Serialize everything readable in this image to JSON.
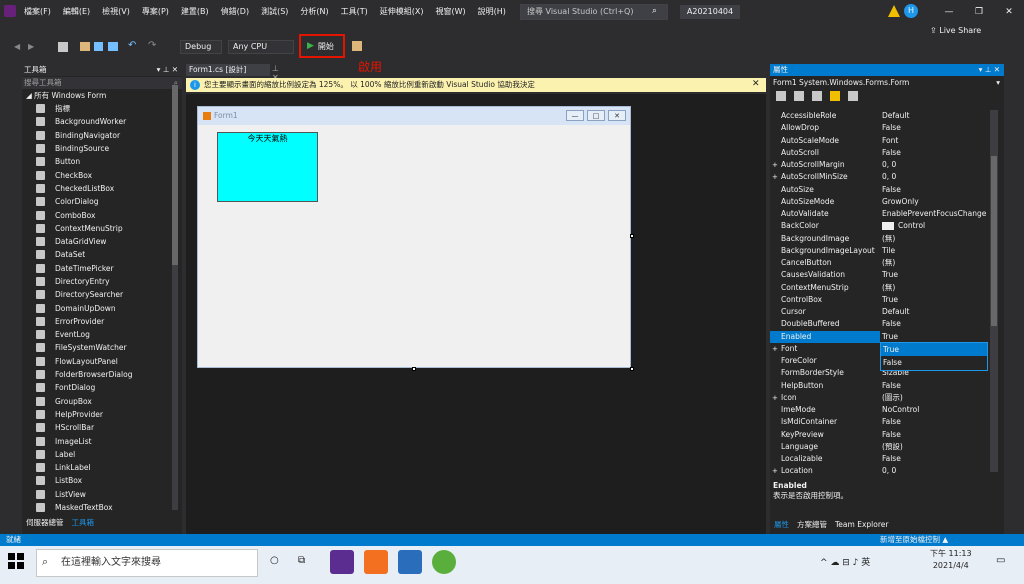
{
  "menubar": [
    "檔案(F)",
    "編輯(E)",
    "檢視(V)",
    "專案(P)",
    "建置(B)",
    "偵錯(D)",
    "測試(S)",
    "分析(N)",
    "工具(T)",
    "延伸模組(X)",
    "視窗(W)",
    "說明(H)"
  ],
  "search": {
    "placeholder": "搜尋 Visual Studio (Ctrl+Q)"
  },
  "solution_name": "A20210404",
  "live_share": "Live Share",
  "toolbar": {
    "config": "Debug",
    "platform": "Any CPU",
    "start": "開始",
    "start_annotation": "啟用"
  },
  "toolbox": {
    "title": "工具箱",
    "search": "搜尋工具箱",
    "group": "所有 Windows Form",
    "items": [
      "指標",
      "BackgroundWorker",
      "BindingNavigator",
      "BindingSource",
      "Button",
      "CheckBox",
      "CheckedListBox",
      "ColorDialog",
      "ComboBox",
      "ContextMenuStrip",
      "DataGridView",
      "DataSet",
      "DateTimePicker",
      "DirectoryEntry",
      "DirectorySearcher",
      "DomainUpDown",
      "ErrorProvider",
      "EventLog",
      "FileSystemWatcher",
      "FlowLayoutPanel",
      "FolderBrowserDialog",
      "FontDialog",
      "GroupBox",
      "HelpProvider",
      "HScrollBar",
      "ImageList",
      "Label",
      "LinkLabel",
      "ListBox",
      "ListView",
      "MaskedTextBox"
    ],
    "tabs": [
      "伺服器總管",
      "工具箱"
    ]
  },
  "document": {
    "tab": "Form1.cs [設計]",
    "info": "您主要顯示畫面的縮放比例設定為 125%。  以 100% 縮放比例重新啟動 Visual Studio   協助我決定",
    "form_title": "Form1",
    "box_text": "今天天氣熱"
  },
  "properties": {
    "title": "屬性",
    "object": "Form1  System.Windows.Forms.Form",
    "rows": [
      [
        "",
        "AccessibleRole",
        "Default"
      ],
      [
        "",
        "AllowDrop",
        "False"
      ],
      [
        "",
        "AutoScaleMode",
        "Font"
      ],
      [
        "",
        "AutoScroll",
        "False"
      ],
      [
        "+",
        "AutoScrollMargin",
        "0, 0"
      ],
      [
        "+",
        "AutoScrollMinSize",
        "0, 0"
      ],
      [
        "",
        "AutoSize",
        "False"
      ],
      [
        "",
        "AutoSizeMode",
        "GrowOnly"
      ],
      [
        "",
        "AutoValidate",
        "EnablePreventFocusChange"
      ],
      [
        "",
        "BackColor",
        "Control"
      ],
      [
        "",
        "BackgroundImage",
        "(無)"
      ],
      [
        "",
        "BackgroundImageLayout",
        "Tile"
      ],
      [
        "",
        "CancelButton",
        "(無)"
      ],
      [
        "",
        "CausesValidation",
        "True"
      ],
      [
        "",
        "ContextMenuStrip",
        "(無)"
      ],
      [
        "",
        "ControlBox",
        "True"
      ],
      [
        "",
        "Cursor",
        "Default"
      ],
      [
        "",
        "DoubleBuffered",
        "False"
      ],
      [
        "",
        "Enabled",
        "True"
      ],
      [
        "+",
        "Font",
        ""
      ],
      [
        "",
        "ForeColor",
        ""
      ],
      [
        "",
        "FormBorderStyle",
        "Sizable"
      ],
      [
        "",
        "HelpButton",
        "False"
      ],
      [
        "+",
        "Icon",
        "(圖示)"
      ],
      [
        "",
        "ImeMode",
        "NoControl"
      ],
      [
        "",
        "IsMdiContainer",
        "False"
      ],
      [
        "",
        "KeyPreview",
        "False"
      ],
      [
        "",
        "Language",
        "(預設)"
      ],
      [
        "",
        "Localizable",
        "False"
      ],
      [
        "+",
        "Location",
        "0, 0"
      ]
    ],
    "dropdown": [
      "True",
      "False"
    ],
    "desc_title": "Enabled",
    "desc_text": "表示是否啟用控制項。",
    "tabs": [
      "屬性",
      "方案總管",
      "Team Explorer"
    ]
  },
  "status": {
    "ready": "就緒",
    "source_control": "新增至原始檔控制 ▲"
  },
  "taskbar": {
    "search": "在這裡輸入文字來搜尋",
    "time": "下午 11:13",
    "date": "2021/4/4",
    "ime": "英"
  },
  "colors": {
    "accent": "#007acc",
    "form_box": "#00ffff",
    "highlight": "#e51400"
  }
}
